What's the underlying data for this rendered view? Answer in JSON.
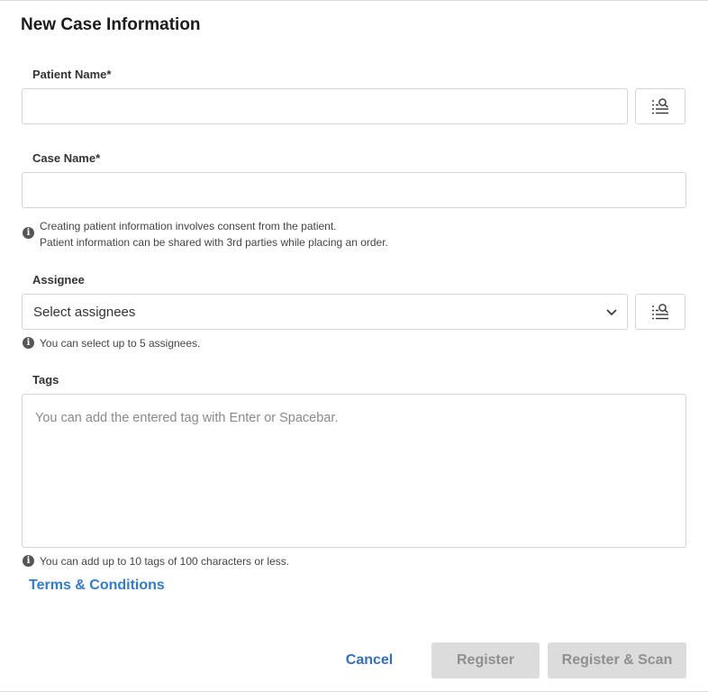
{
  "dialog": {
    "title": "New Case Information"
  },
  "patient_name": {
    "label": "Patient Name*",
    "value": "",
    "placeholder": ""
  },
  "case_name": {
    "label": "Case Name*",
    "value": "",
    "placeholder": ""
  },
  "consent_note": {
    "line1": "Creating patient information involves consent from the patient.",
    "line2": "Patient information can be shared with 3rd parties while placing an order."
  },
  "assignee": {
    "label": "Assignee",
    "selected_text": "Select assignees",
    "note": "You can select up to 5 assignees."
  },
  "tags": {
    "label": "Tags",
    "placeholder": "You can add the entered tag with Enter or Spacebar.",
    "note": "You can add up to 10 tags of 100 characters or less."
  },
  "terms_link": "Terms & Conditions",
  "footer": {
    "cancel_label": "Cancel",
    "register_label": "Register",
    "register_scan_label": "Register & Scan"
  },
  "icons": {
    "info": "info-icon",
    "search_list": "search-list-icon",
    "chevron": "chevron-down-icon"
  },
  "colors": {
    "link": "#2f7bd5",
    "disabled_button_bg": "#dcdcdc",
    "disabled_button_text": "#8f8f8f"
  }
}
